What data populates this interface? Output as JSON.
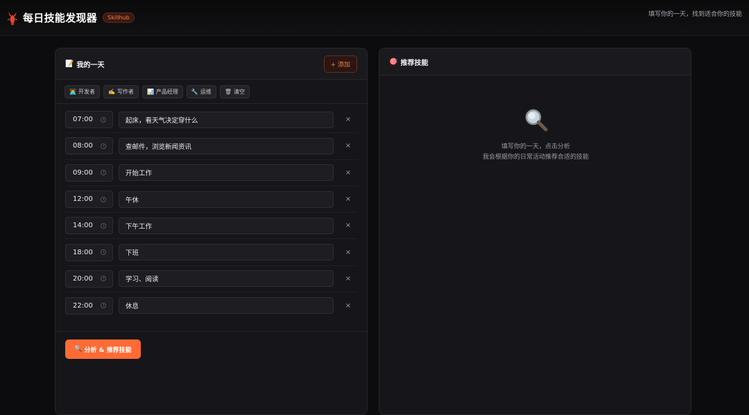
{
  "app": {
    "title": "每日技能发现器",
    "badge": "Skillhub",
    "tagline": "填写你的一天，找到适合你的技能",
    "accent": "#ff6b35"
  },
  "left_panel": {
    "icon": "📝",
    "title": "我的一天",
    "add_label": "+ 添加",
    "presets": [
      {
        "icon": "👨‍💻",
        "label": "开发者"
      },
      {
        "icon": "✍️",
        "label": "写作者"
      },
      {
        "icon": "📊",
        "label": "产品经理"
      },
      {
        "icon": "🔧",
        "label": "运维"
      },
      {
        "icon": "🗑",
        "label": "清空"
      }
    ],
    "entries": [
      {
        "time": "07:00",
        "activity": "起床，看天气决定穿什么"
      },
      {
        "time": "08:00",
        "activity": "查邮件，浏览新闻资讯"
      },
      {
        "time": "09:00",
        "activity": "开始工作"
      },
      {
        "time": "12:00",
        "activity": "午休"
      },
      {
        "time": "14:00",
        "activity": "下午工作"
      },
      {
        "time": "18:00",
        "activity": "下班"
      },
      {
        "time": "20:00",
        "activity": "学习、阅读"
      },
      {
        "time": "22:00",
        "activity": "休息"
      }
    ],
    "remove_symbol": "×",
    "analyze": {
      "icon": "🔍",
      "label": "分析 & 推荐技能"
    }
  },
  "right_panel": {
    "icon": "🎯",
    "title": "推荐技能",
    "empty_line1": "填写你的一天，点击分析",
    "empty_line2": "我会根据你的日常活动推荐合适的技能"
  }
}
